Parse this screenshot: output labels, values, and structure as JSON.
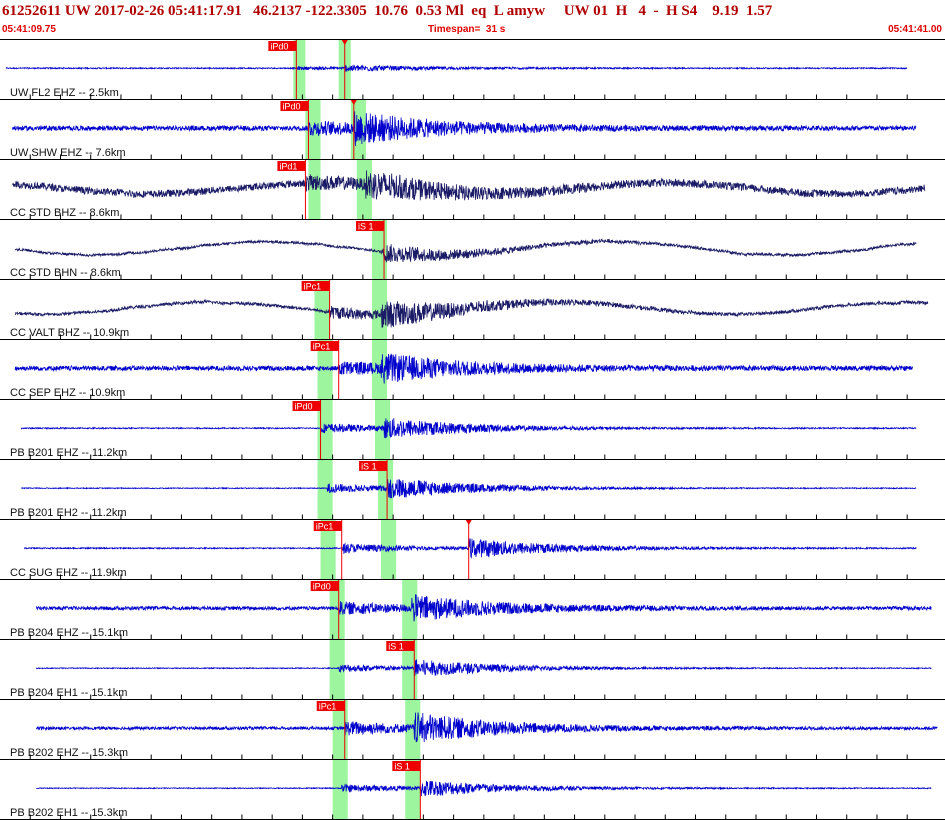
{
  "header": {
    "title": "61252611 UW 2017-02-26 05:41:17.91   46.2137 -122.3305  10.76  0.53 Ml  eq  L amyw     UW 01  H   4  -  H S4    9.19  1.57",
    "start_time": "05:41:09.75",
    "timespan_label": "Timespan=  31 s",
    "end_time": "05:41:41.00"
  },
  "colors": {
    "trace_ehz": "#0000cc",
    "trace_bb": "#1a1a66",
    "pick_flag": "#ee0000",
    "pick_window": "#9df59d",
    "separator": "#000000"
  },
  "chart_data": {
    "type": "line",
    "title": "61252611 UW 2017-02-26 05:41:17.91",
    "x_units": "seconds from 05:41:09.75",
    "xlim": [
      0,
      31.25
    ],
    "channels": [
      {
        "label": "UW FL2 EHZ -- 2.5km",
        "color": "#0000cc",
        "amp": 0.08,
        "noise": 0.02,
        "start": 0.2,
        "end": 30.0,
        "drift": 0.0,
        "p_pick": {
          "label": "iPd0",
          "t": 9.8
        },
        "s_pick": {
          "label": "",
          "t": 11.4
        },
        "green": [
          9.7,
          10.1,
          11.2,
          11.6
        ]
      },
      {
        "label": "UW SHW EHZ -- 7.6km",
        "color": "#0000cc",
        "amp": 0.42,
        "noise": 0.08,
        "start": 0.4,
        "end": 30.3,
        "drift": 0.0,
        "p_pick": {
          "label": "iPd0",
          "t": 10.2
        },
        "s_pick": {
          "label": "",
          "t": 11.7
        },
        "green": [
          10.1,
          10.6,
          11.6,
          12.1
        ]
      },
      {
        "label": "CC STD BHZ -- 8.6km",
        "color": "#1a1a66",
        "amp": 0.34,
        "noise": 0.12,
        "start": 0.4,
        "end": 30.6,
        "drift": 0.18,
        "p_pick": {
          "label": "iPd1",
          "t": 10.1
        },
        "s_pick": {
          "label": "",
          "t": 0
        },
        "green": [
          10.2,
          10.6,
          11.8,
          12.3
        ]
      },
      {
        "label": "CC STD BHN -- 8.6km",
        "color": "#1a1a66",
        "amp": 0.2,
        "noise": 0.04,
        "start": 0.5,
        "end": 30.3,
        "drift": 0.22,
        "p_pick": {
          "label": "",
          "t": 0
        },
        "s_pick": {
          "label": "iS 1",
          "t": 12.7
        },
        "green": [
          12.3,
          12.8
        ]
      },
      {
        "label": "CC VALT BHZ -- 10.9km",
        "color": "#1a1a66",
        "amp": 0.36,
        "noise": 0.05,
        "start": 0.5,
        "end": 30.7,
        "drift": 0.2,
        "p_pick": {
          "label": "iPc1",
          "t": 10.9
        },
        "s_pick": {
          "label": "",
          "t": 0
        },
        "green": [
          10.4,
          10.9,
          12.3,
          12.8
        ]
      },
      {
        "label": "CC SEP EHZ -- 10.9km",
        "color": "#0000cc",
        "amp": 0.36,
        "noise": 0.08,
        "start": 0.5,
        "end": 30.2,
        "drift": 0.0,
        "p_pick": {
          "label": "iPc1",
          "t": 11.2
        },
        "s_pick": {
          "label": "",
          "t": 0
        },
        "green": [
          10.5,
          11.0,
          12.3,
          12.8
        ]
      },
      {
        "label": "PB B201 EHZ -- 11.2km",
        "color": "#0000cc",
        "amp": 0.3,
        "noise": 0.02,
        "start": 0.7,
        "end": 30.3,
        "drift": 0.0,
        "p_pick": {
          "label": "iPd0",
          "t": 10.6
        },
        "s_pick": {
          "label": "",
          "t": 0
        },
        "green": [
          10.5,
          11.0,
          12.4,
          12.9
        ]
      },
      {
        "label": "PB B201 EH2 -- 11.2km",
        "color": "#0000cc",
        "amp": 0.3,
        "noise": 0.015,
        "start": 0.7,
        "end": 30.3,
        "drift": 0.0,
        "p_pick": {
          "label": "",
          "t": 0
        },
        "s_pick": {
          "label": "iS 1",
          "t": 12.8
        },
        "green": [
          10.5,
          11.0,
          12.5,
          13.0
        ]
      },
      {
        "label": "CC SUG EHZ -- 11.9km",
        "color": "#0000cc",
        "amp": 0.3,
        "noise": 0.02,
        "start": 0.8,
        "end": 30.3,
        "drift": 0.0,
        "p_pick": {
          "label": "iPc1",
          "t": 11.3
        },
        "s_pick": {
          "label": "",
          "t": 15.5
        },
        "green": [
          10.6,
          11.1,
          12.6,
          13.1
        ]
      },
      {
        "label": "PB B204 EHZ -- 15.1km",
        "color": "#0000cc",
        "amp": 0.36,
        "noise": 0.06,
        "start": 1.2,
        "end": 30.8,
        "drift": 0.0,
        "p_pick": {
          "label": "iPd0",
          "t": 11.2
        },
        "s_pick": {
          "label": "",
          "t": 0
        },
        "green": [
          10.9,
          11.4,
          13.3,
          13.8
        ]
      },
      {
        "label": "PB B204 EH1 -- 15.1km",
        "color": "#0000cc",
        "amp": 0.25,
        "noise": 0.015,
        "start": 1.2,
        "end": 30.8,
        "drift": 0.0,
        "p_pick": {
          "label": "",
          "t": 0
        },
        "s_pick": {
          "label": "iS 1",
          "t": 13.7
        },
        "green": [
          10.9,
          11.4,
          13.3,
          13.8
        ]
      },
      {
        "label": "PB B202 EHZ -- 15.3km",
        "color": "#0000cc",
        "amp": 0.42,
        "noise": 0.05,
        "start": 1.2,
        "end": 31.0,
        "drift": 0.0,
        "p_pick": {
          "label": "iPc1",
          "t": 11.4
        },
        "s_pick": {
          "label": "",
          "t": 0
        },
        "green": [
          11.0,
          11.5,
          13.4,
          13.9
        ]
      },
      {
        "label": "PB B202 EH1 -- 15.3km",
        "color": "#0000cc",
        "amp": 0.25,
        "noise": 0.015,
        "start": 1.2,
        "end": 30.8,
        "drift": 0.0,
        "p_pick": {
          "label": "",
          "t": 0
        },
        "s_pick": {
          "label": "iS 1",
          "t": 13.9
        },
        "green": [
          11.0,
          11.5,
          13.4,
          13.9
        ]
      }
    ]
  }
}
